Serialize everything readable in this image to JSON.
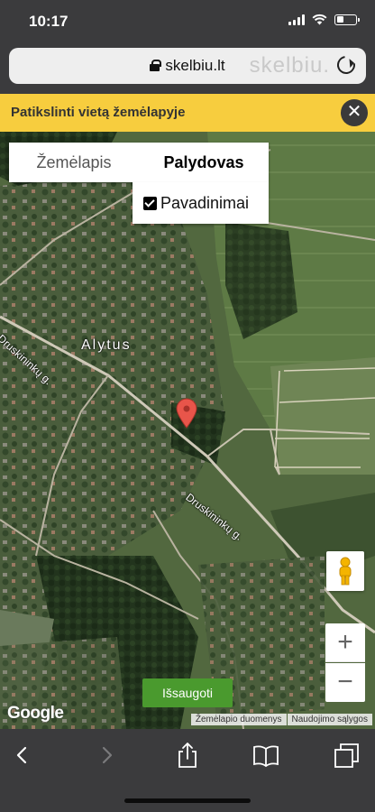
{
  "status_bar": {
    "time": "10:17",
    "battery_level": 0.35
  },
  "browser": {
    "url": "skelbiu.lt",
    "watermark": "skelbiu."
  },
  "header": {
    "title": "Patikslinti vietą žemėlapyje"
  },
  "map": {
    "tabs": [
      {
        "label": "Žemėlapis",
        "active": false
      },
      {
        "label": "Palydovas",
        "active": true
      }
    ],
    "labels_option": {
      "label": "Pavadinimai",
      "checked": true
    },
    "town_label": "Alytus",
    "street_label_1": "Druskininkų g.",
    "street_label_2": "Druskininkų g.",
    "zoom_in": "+",
    "zoom_out": "−",
    "save_label": "Išsaugoti",
    "google_logo": "Google",
    "footer": {
      "map_data": "Žemėlapio duomenys",
      "terms": "Naudojimo sąlygos"
    },
    "colors": {
      "accent_yellow": "#f7cd3e",
      "save_green": "#4a9a2e",
      "pin_red": "#e8554a"
    }
  },
  "toolbar": {
    "icons": [
      "back-icon",
      "forward-icon",
      "share-icon",
      "bookmarks-icon",
      "tabs-icon"
    ]
  }
}
